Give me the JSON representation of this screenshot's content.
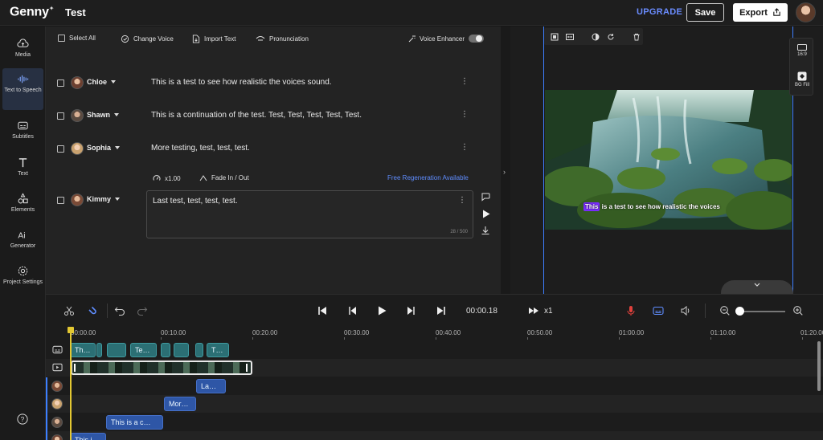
{
  "app": {
    "brand": "Genny",
    "project_title": "Test",
    "upgrade_label": "UPGRADE",
    "save_label": "Save",
    "export_label": "Export"
  },
  "sidebar": {
    "items": [
      {
        "label": "Media",
        "icon": "cloud-upload-icon"
      },
      {
        "label": "Text to Speech",
        "icon": "waveform-icon"
      },
      {
        "label": "Subtitles",
        "icon": "subtitles-icon"
      },
      {
        "label": "Text",
        "icon": "text-icon"
      },
      {
        "label": "Elements",
        "icon": "shapes-icon"
      },
      {
        "label": "Generator",
        "icon": "ai-icon"
      },
      {
        "label": "Project Settings",
        "icon": "gear-icon"
      }
    ]
  },
  "script_toolbar": {
    "select_all": "Select All",
    "change_voice": "Change Voice",
    "import_text": "Import Text",
    "pronunciation": "Pronunciation",
    "voice_enhancer": "Voice Enhancer"
  },
  "script_rows": [
    {
      "speaker": "Chloe",
      "text": "This is a test to see how realistic the voices sound."
    },
    {
      "speaker": "Shawn",
      "text": "This is a continuation of the test. Test, Test, Test, Test, Test."
    },
    {
      "speaker": "Sophia",
      "text": "More testing, test, test, test."
    }
  ],
  "active_row": {
    "speed": "x1.00",
    "fade": "Fade In / Out",
    "regen": "Free Regeneration Available",
    "speaker": "Kimmy",
    "text": "Last test, test, test, test.",
    "char_count": "28 / 500"
  },
  "preview": {
    "caption_highlight": "This",
    "caption_rest": " is a test to see how realistic the voices",
    "ratio_label": "16:9",
    "bg_fill_label": "BG Fill"
  },
  "timeline": {
    "current_time": "00:00.18",
    "speed": "x1",
    "ruler": [
      "00:00.00",
      "00:10.00",
      "00:20.00",
      "00:30.00",
      "00:40.00",
      "00:50.00",
      "01:00.00",
      "01:10.00",
      "01:20.00"
    ],
    "subtitle_clips": [
      "Th…",
      "",
      "",
      "Te…",
      "",
      "",
      "",
      "T…"
    ],
    "voice_clips": [
      "La…",
      "Mor…",
      "This is a c…",
      "This i…"
    ]
  },
  "colors": {
    "accent_blue": "#3d7fff",
    "upgrade": "#6a8cff",
    "subtitle_clip": "#2b6f74",
    "voice_clip": "#2e56a6",
    "playhead": "#e3c832",
    "caption_highlight": "#7a2cff",
    "record": "#e0413c"
  }
}
